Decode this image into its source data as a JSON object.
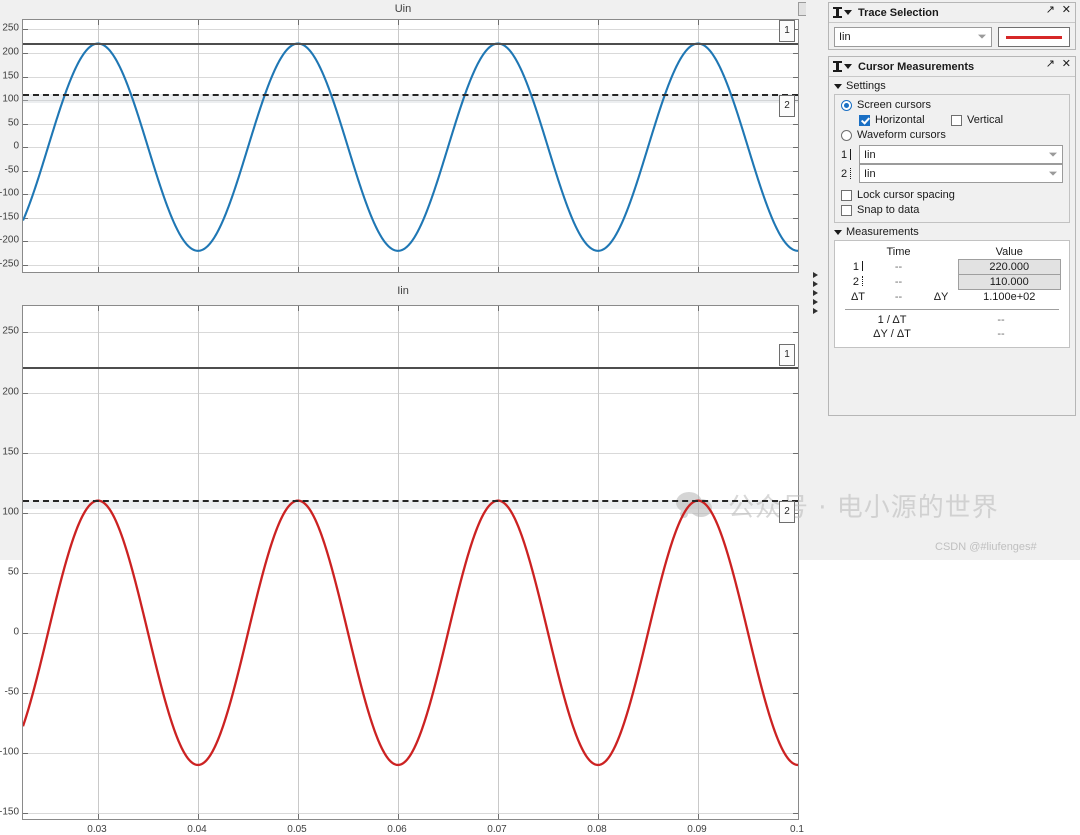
{
  "scope": {
    "restore_button_name": "restore",
    "splitter_name": "panel-splitter"
  },
  "plots": [
    {
      "title": "Uin",
      "cursor_tag_1": "1",
      "cursor_tag_2": "2"
    },
    {
      "title": "Iin",
      "cursor_tag_1": "1",
      "cursor_tag_2": "2"
    }
  ],
  "trace_selection": {
    "title": "Trace Selection",
    "selected": "Iin",
    "swatch_color": "#d62728",
    "close_glyph": "✕",
    "undock_glyph": "↗"
  },
  "cursor_measurements": {
    "title": "Cursor Measurements",
    "settings_label": "Settings",
    "screen_cursors_label": "Screen cursors",
    "screen_cursors_selected": true,
    "horizontal_label": "Horizontal",
    "horizontal_checked": true,
    "vertical_label": "Vertical",
    "vertical_checked": false,
    "waveform_cursors_label": "Waveform cursors",
    "waveform_cursors_selected": false,
    "cursor1_index": "1",
    "cursor1_source": "Iin",
    "cursor2_index": "2",
    "cursor2_source": "Iin",
    "lock_spacing_label": "Lock cursor spacing",
    "lock_spacing_checked": false,
    "snap_to_data_label": "Snap to data",
    "snap_to_data_checked": false,
    "measurements_label": "Measurements",
    "table": {
      "col_time": "Time",
      "col_value": "Value",
      "rows": [
        {
          "label": "1",
          "time": "--",
          "value": "220.000"
        },
        {
          "label": "2",
          "time": "--",
          "value": "110.000"
        }
      ],
      "delta_t_label": "ΔT",
      "delta_t_value": "--",
      "delta_y_label": "ΔY",
      "delta_y_value": "1.100e+02",
      "inv_delta_t_label": "1 / ΔT",
      "inv_delta_t_value": "--",
      "slope_label": "ΔY / ΔT",
      "slope_value": "--"
    },
    "close_glyph": "✕",
    "undock_glyph": "↗"
  },
  "watermark": {
    "text": "公众号 · 电小源的世界",
    "credit": "CSDN @#liufenges#"
  },
  "chart_data": [
    {
      "type": "line",
      "title": "Uin",
      "xlabel": "",
      "ylabel": "",
      "xlim": [
        0.0225,
        0.1
      ],
      "ylim": [
        -265,
        270
      ],
      "xticks": [
        0.03,
        0.04,
        0.05,
        0.06,
        0.07,
        0.08,
        0.09,
        0.1
      ],
      "yticks": [
        250,
        200,
        150,
        100,
        50,
        0,
        -50,
        -100,
        -150,
        -200,
        -250
      ],
      "grid": true,
      "series": [
        {
          "name": "Uin",
          "color": "#1f77b4",
          "waveform": "sine",
          "amplitude": 220,
          "frequency_hz": 50,
          "phase_deg": -90,
          "offset": 0,
          "peaks_at": [
            0.025,
            0.045,
            0.065,
            0.085
          ],
          "troughs_at": [
            0.035,
            0.055,
            0.075,
            0.095
          ]
        }
      ],
      "cursors": [
        {
          "id": "1",
          "style": "solid",
          "y": 220
        },
        {
          "id": "2",
          "style": "dashed",
          "y": 110
        }
      ]
    },
    {
      "type": "line",
      "title": "Iin",
      "xlabel": "",
      "ylabel": "",
      "xlim": [
        0.0225,
        0.1
      ],
      "ylim": [
        -155,
        272
      ],
      "xticks": [
        0.03,
        0.04,
        0.05,
        0.06,
        0.07,
        0.08,
        0.09,
        0.1
      ],
      "yticks": [
        250,
        200,
        150,
        100,
        50,
        0,
        -50,
        -100,
        -150
      ],
      "grid": true,
      "series": [
        {
          "name": "Iin",
          "color": "#cc2222",
          "waveform": "sine",
          "amplitude": 110,
          "frequency_hz": 50,
          "phase_deg": -90,
          "offset": 0,
          "peaks_at": [
            0.025,
            0.045,
            0.065,
            0.085
          ],
          "troughs_at": [
            0.035,
            0.055,
            0.075,
            0.095
          ]
        }
      ],
      "cursors": [
        {
          "id": "1",
          "style": "solid",
          "y": 220
        },
        {
          "id": "2",
          "style": "dashed",
          "y": 110
        }
      ]
    }
  ]
}
